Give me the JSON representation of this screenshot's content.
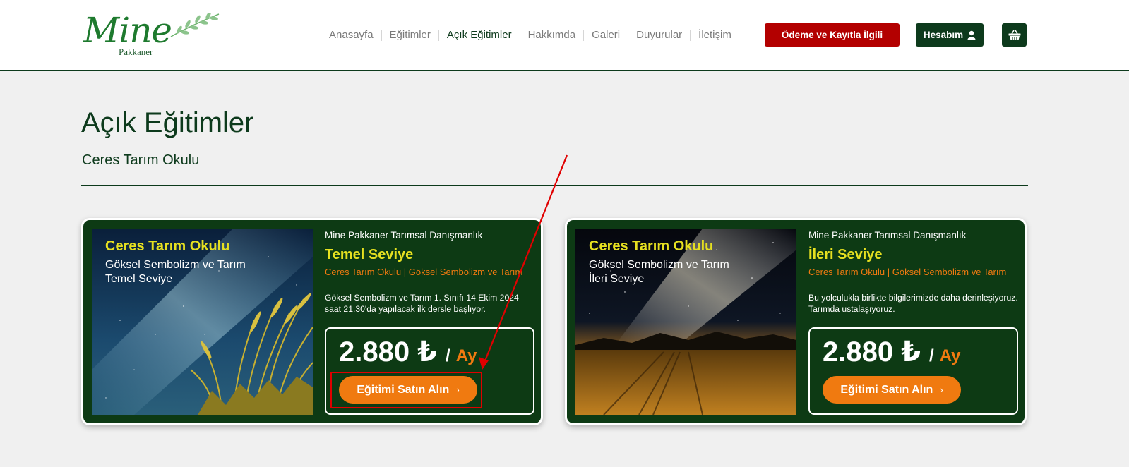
{
  "brand": {
    "logo_main": "Mine",
    "logo_sub": "Pakkaner"
  },
  "nav": {
    "items": [
      {
        "label": "Anasayfa"
      },
      {
        "label": "Eğitimler"
      },
      {
        "label": "Açık Eğitimler",
        "active": true
      },
      {
        "label": "Hakkımda"
      },
      {
        "label": "Galeri"
      },
      {
        "label": "Duyurular"
      },
      {
        "label": "İletişim"
      }
    ],
    "payment_button": "Ödeme ve Kayıtla İlgili",
    "account_button": "Hesabım",
    "cart_icon": "basket-icon"
  },
  "page": {
    "title": "Açık Eğitimler",
    "subtitle": "Ceres Tarım Okulu"
  },
  "courses": [
    {
      "image_title": "Ceres Tarım Okulu",
      "image_line1": "Göksel Sembolizm ve Tarım",
      "image_line2": "Temel Seviye",
      "org": "Mine Pakkaner Tarımsal Danışmanlık",
      "level": "Temel Seviye",
      "category": "Ceres Tarım Okulu | Göksel Sembolizm ve Tarım",
      "description": "Göksel Sembolizm ve Tarım 1. Sınıfı 14 Ekim 2024 saat 21.30'da yapılacak ilk dersle başlıyor.",
      "price": "2.880 ₺",
      "price_sep": "/",
      "price_unit": "Ay",
      "buy_label": "Eğitimi Satın Alın"
    },
    {
      "image_title": "Ceres Tarım Okulu",
      "image_line1": "Göksel Sembolizm ve Tarım",
      "image_line2": "İleri Seviye",
      "org": "Mine Pakkaner Tarımsal Danışmanlık",
      "level": "İleri Seviye",
      "category": "Ceres Tarım Okulu | Göksel Sembolizm ve Tarım",
      "description": "Bu yolculukla birlikte bilgilerimizde daha derinleşiyoruz. Tarımda ustalaşıyoruz.",
      "price": "2.880 ₺",
      "price_sep": "/",
      "price_unit": "Ay",
      "buy_label": "Eğitimi Satın Alın"
    }
  ],
  "colors": {
    "brand_green": "#0d3a1c",
    "accent_orange": "#f07a10",
    "accent_yellow": "#e6e020",
    "payment_red": "#b30000",
    "annotation_red": "#e00000"
  }
}
